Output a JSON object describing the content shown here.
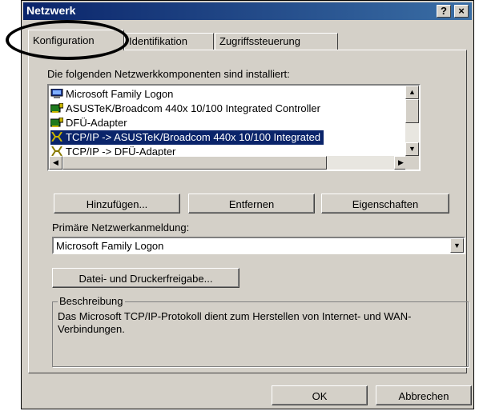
{
  "window": {
    "title": "Netzwerk",
    "help_glyph": "?",
    "close_glyph": "×"
  },
  "tabs": [
    {
      "label": "Konfiguration",
      "active": true
    },
    {
      "label": "Identifikation",
      "active": false
    },
    {
      "label": "Zugriffssteuerung",
      "active": false
    }
  ],
  "components": {
    "heading": "Die folgenden Netzwerkkomponenten sind installiert:",
    "items": [
      {
        "label": "Microsoft Family Logon",
        "icon": "computer-icon",
        "selected": false
      },
      {
        "label": "ASUSTeK/Broadcom 440x 10/100 Integrated Controller",
        "icon": "network-card-icon",
        "selected": false
      },
      {
        "label": "DFÜ-Adapter",
        "icon": "network-card-icon",
        "selected": false
      },
      {
        "label": "TCP/IP -> ASUSTeK/Broadcom 440x 10/100 Integrated",
        "icon": "protocol-icon",
        "selected": true
      },
      {
        "label": "TCP/IP -> DFÜ-Adapter",
        "icon": "protocol-icon",
        "selected": false
      }
    ]
  },
  "buttons": {
    "add": "Hinzufügen...",
    "remove": "Entfernen",
    "properties": "Eigenschaften",
    "file_print_sharing": "Datei- und Druckerfreigabe...",
    "ok": "OK",
    "cancel": "Abbrechen"
  },
  "primary_logon": {
    "label": "Primäre Netzwerkanmeldung:",
    "value": "Microsoft Family Logon"
  },
  "description": {
    "legend": "Beschreibung",
    "text": "Das Microsoft TCP/IP-Protokoll dient zum Herstellen von Internet- und WAN-Verbindungen."
  },
  "colors": {
    "selection": "#0a246a",
    "face": "#d4d0c8",
    "annotation": "#000000"
  }
}
